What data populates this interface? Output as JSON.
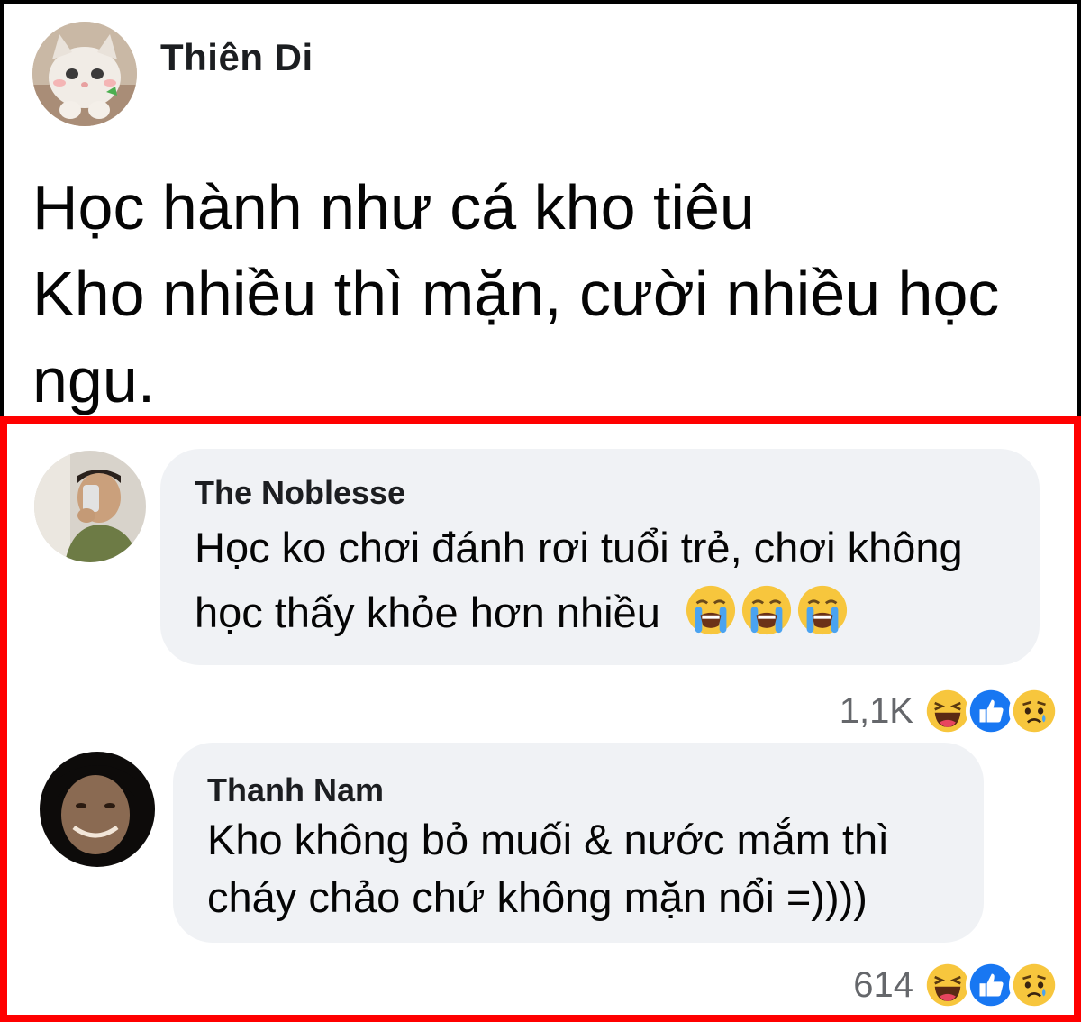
{
  "post": {
    "author": "Thiên Di",
    "lines": [
      "Học hành như cá kho tiêu",
      "Kho nhiều thì mặn, cười nhiều học",
      "ngu."
    ]
  },
  "comments": [
    {
      "name": "The Noblesse",
      "lines": [
        "Học ko chơi đánh rơi tuổi trẻ, chơi không",
        "học thấy khỏe hơn nhiều"
      ],
      "inline_emoji": [
        "loudly-crying-face-icon",
        "loudly-crying-face-icon",
        "loudly-crying-face-icon"
      ],
      "reaction_count": "1,1K",
      "reactions": [
        "haha-icon",
        "like-icon",
        "sad-icon"
      ]
    },
    {
      "name": "Thanh Nam",
      "lines": [
        "Kho không bỏ muối & nước mắm thì",
        "cháy chảo chứ không mặn nổi =))))"
      ],
      "reaction_count": "614",
      "reactions": [
        "haha-icon",
        "like-icon",
        "sad-icon"
      ]
    }
  ],
  "colors": {
    "frame": "#ff0000",
    "bubble": "#f0f2f5",
    "like_blue": "#1877f2",
    "emoji_yellow": "#f7c63d"
  }
}
